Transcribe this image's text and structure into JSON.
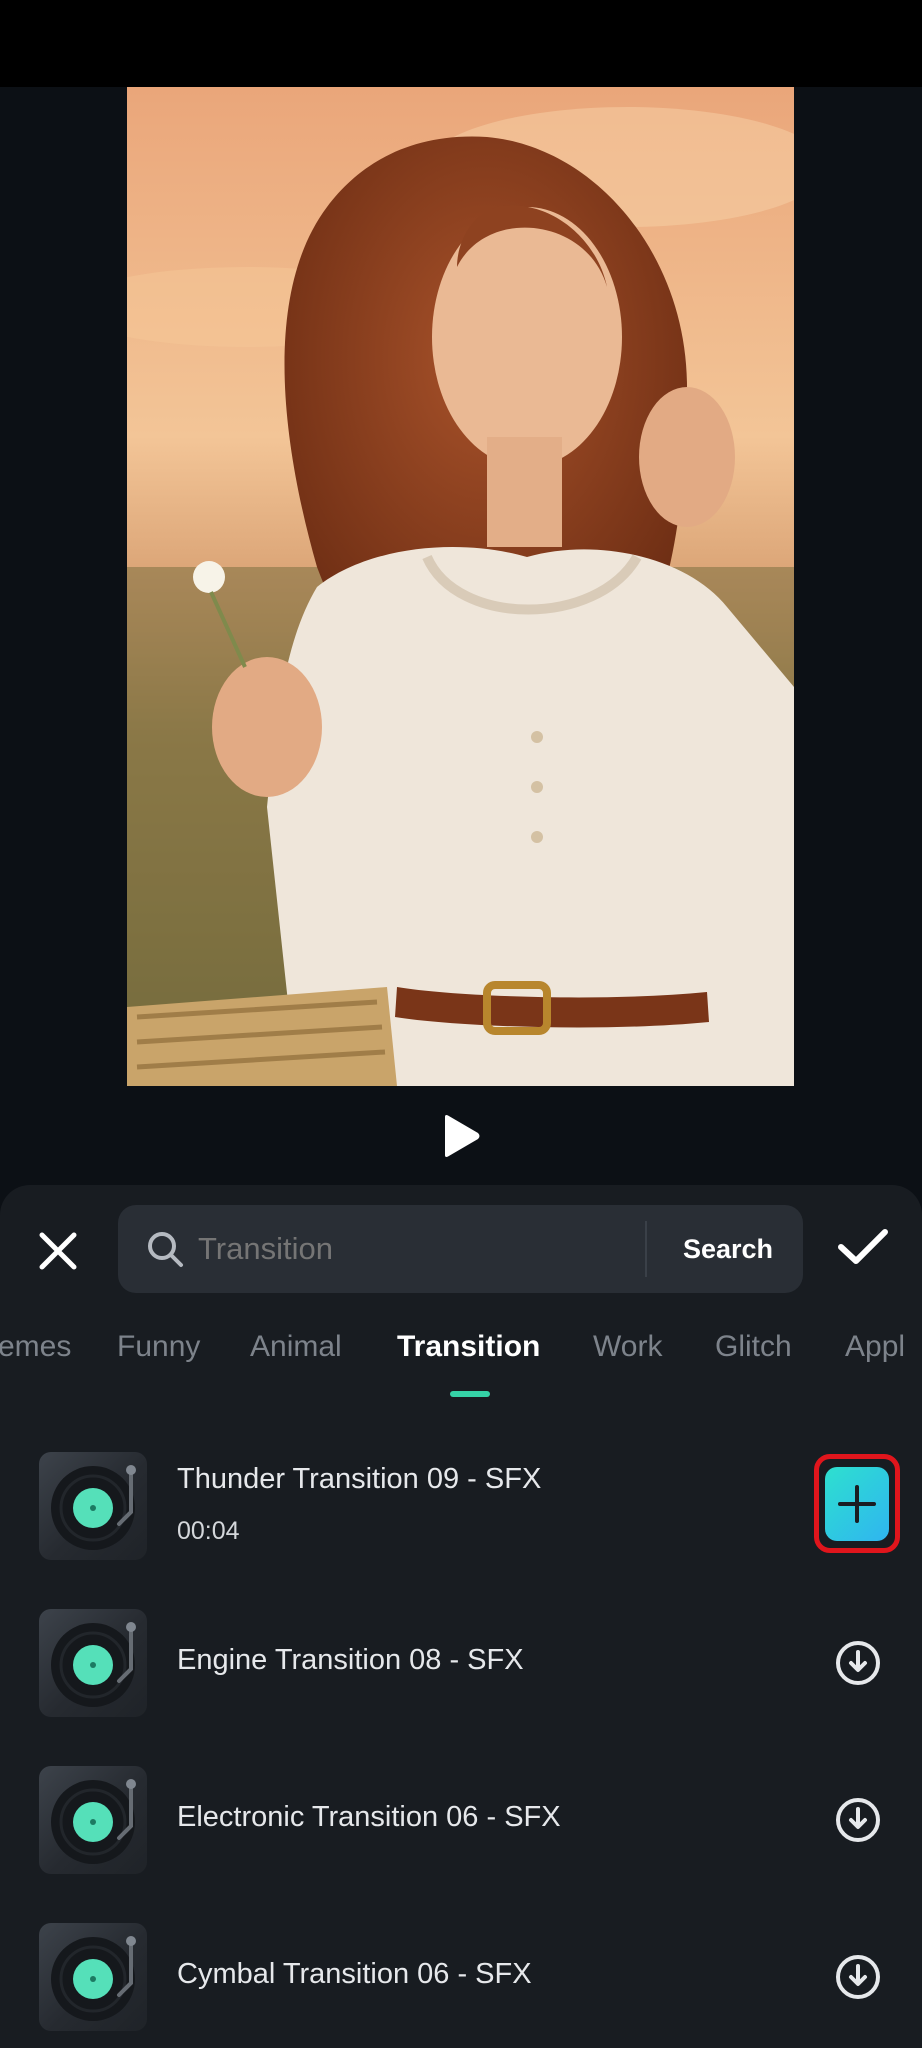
{
  "search": {
    "placeholder": "Transition",
    "button_label": "Search"
  },
  "tabs": [
    {
      "label": "emes"
    },
    {
      "label": "Funny"
    },
    {
      "label": "Animal"
    },
    {
      "label": "Transition",
      "active": true
    },
    {
      "label": "Work"
    },
    {
      "label": "Glitch"
    },
    {
      "label": "Appl"
    }
  ],
  "items": [
    {
      "title": "Thunder Transition 09 - SFX",
      "duration": "00:04",
      "action": "add"
    },
    {
      "title": "Engine Transition 08 - SFX",
      "action": "download"
    },
    {
      "title": "Electronic Transition 06 - SFX",
      "action": "download"
    },
    {
      "title": "Cymbal Transition 06 - SFX",
      "action": "download"
    }
  ],
  "colors": {
    "accent": "#35d2a7",
    "panel_bg": "#181c21",
    "add_button": "#2fb5f0",
    "highlight_border": "#e0151c"
  },
  "icons": [
    "play-icon",
    "close-icon",
    "search-icon",
    "checkmark-icon",
    "vinyl-record-icon",
    "download-icon",
    "plus-icon"
  ]
}
